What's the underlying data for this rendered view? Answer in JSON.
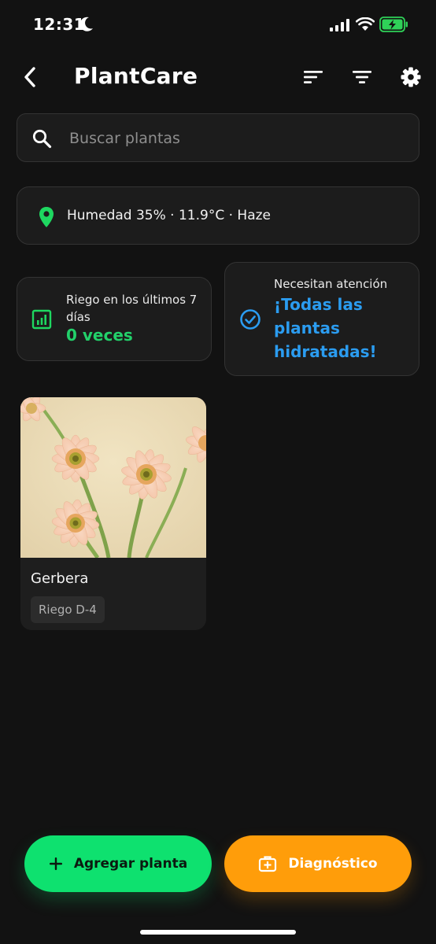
{
  "status_bar": {
    "time": "12:31",
    "icons": [
      "moon-icon",
      "signal-icon",
      "wifi-icon",
      "battery-charging-icon"
    ]
  },
  "header": {
    "title": "PlantCare",
    "icons": [
      "back-arrow-icon",
      "sort-icon",
      "filter-icon",
      "gear-icon"
    ]
  },
  "search": {
    "placeholder": "Buscar plantas",
    "value": ""
  },
  "weather": {
    "text": "Humedad 35% · 11.9°C · Haze",
    "icon": "location-pin-icon"
  },
  "stats": {
    "watering": {
      "label": "Riego en los últimos 7 días",
      "value": "0 veces",
      "icon": "bar-chart-icon"
    },
    "attention": {
      "label": "Necesitan atención",
      "value": "¡Todas las plantas hidratadas!",
      "icon": "check-circle-icon"
    }
  },
  "plants": [
    {
      "name": "Gerbera",
      "badge": "Riego D-4"
    }
  ],
  "actions": {
    "add_label": "Agregar planta",
    "diagnostic_label": "Diagnóstico"
  },
  "colors": {
    "background": "#121212",
    "card": "#1c1c1c",
    "accent_green": "#0ee16f",
    "accent_orange": "#ff9d0a",
    "accent_blue": "#2b9cf0",
    "value_green": "#22d06a"
  }
}
